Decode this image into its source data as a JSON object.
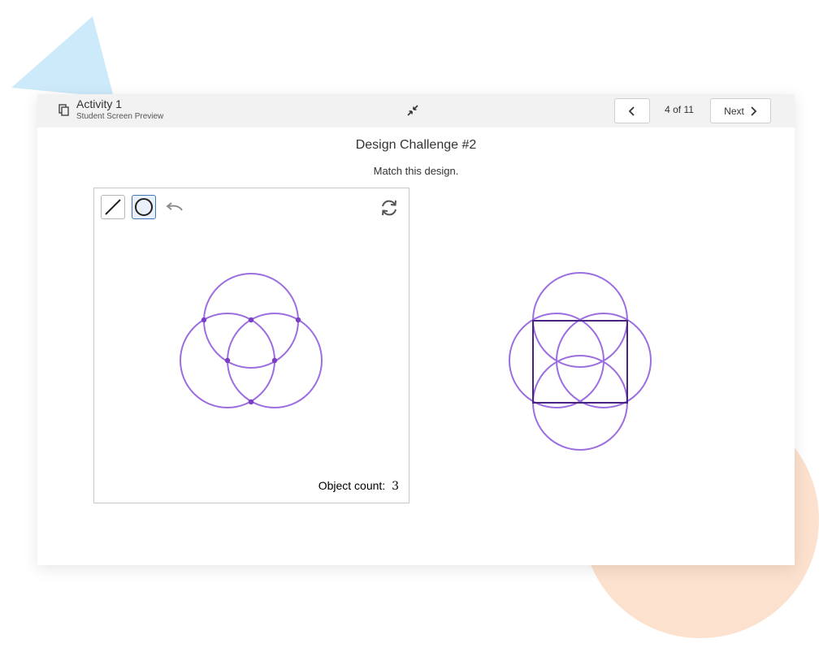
{
  "header": {
    "title": "Activity 1",
    "subtitle": "Student Screen Preview",
    "page_indicator": "4 of 11",
    "next_label": "Next"
  },
  "content": {
    "heading": "Design Challenge #2",
    "instruction": "Match this design."
  },
  "canvas": {
    "object_count_label": "Object count:",
    "object_count": "3"
  },
  "icons": {
    "document": "copy-icon",
    "collapse": "collapse-arrows-icon",
    "prev": "chevron-left-icon",
    "next": "chevron-right-icon",
    "line_tool": "line-tool-icon",
    "circle_tool": "circle-tool-icon",
    "undo": "undo-icon",
    "reset": "reset-icon"
  },
  "colors": {
    "circle": "#9c6ee0",
    "point": "#7b3fc4",
    "target_square": "#4a2382",
    "selected_tool": "#3d78b8",
    "deco_triangle": "#cdeafa",
    "deco_circle": "#fde1cf"
  }
}
